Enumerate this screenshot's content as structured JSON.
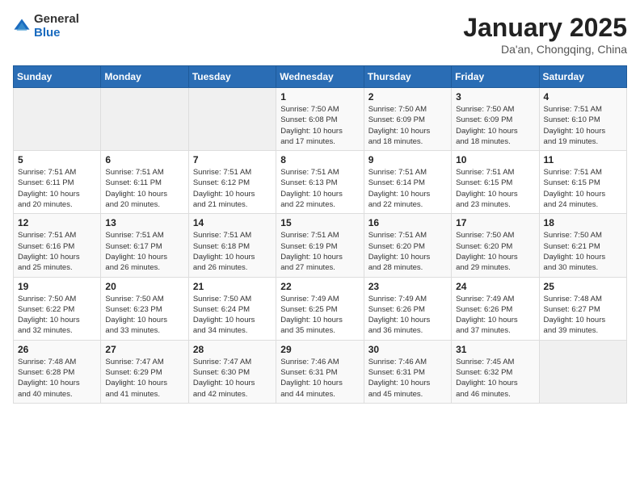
{
  "header": {
    "logo_general": "General",
    "logo_blue": "Blue",
    "title": "January 2025",
    "location": "Da'an, Chongqing, China"
  },
  "weekdays": [
    "Sunday",
    "Monday",
    "Tuesday",
    "Wednesday",
    "Thursday",
    "Friday",
    "Saturday"
  ],
  "weeks": [
    [
      {
        "day": "",
        "info": ""
      },
      {
        "day": "",
        "info": ""
      },
      {
        "day": "",
        "info": ""
      },
      {
        "day": "1",
        "info": "Sunrise: 7:50 AM\nSunset: 6:08 PM\nDaylight: 10 hours\nand 17 minutes."
      },
      {
        "day": "2",
        "info": "Sunrise: 7:50 AM\nSunset: 6:09 PM\nDaylight: 10 hours\nand 18 minutes."
      },
      {
        "day": "3",
        "info": "Sunrise: 7:50 AM\nSunset: 6:09 PM\nDaylight: 10 hours\nand 18 minutes."
      },
      {
        "day": "4",
        "info": "Sunrise: 7:51 AM\nSunset: 6:10 PM\nDaylight: 10 hours\nand 19 minutes."
      }
    ],
    [
      {
        "day": "5",
        "info": "Sunrise: 7:51 AM\nSunset: 6:11 PM\nDaylight: 10 hours\nand 20 minutes."
      },
      {
        "day": "6",
        "info": "Sunrise: 7:51 AM\nSunset: 6:11 PM\nDaylight: 10 hours\nand 20 minutes."
      },
      {
        "day": "7",
        "info": "Sunrise: 7:51 AM\nSunset: 6:12 PM\nDaylight: 10 hours\nand 21 minutes."
      },
      {
        "day": "8",
        "info": "Sunrise: 7:51 AM\nSunset: 6:13 PM\nDaylight: 10 hours\nand 22 minutes."
      },
      {
        "day": "9",
        "info": "Sunrise: 7:51 AM\nSunset: 6:14 PM\nDaylight: 10 hours\nand 22 minutes."
      },
      {
        "day": "10",
        "info": "Sunrise: 7:51 AM\nSunset: 6:15 PM\nDaylight: 10 hours\nand 23 minutes."
      },
      {
        "day": "11",
        "info": "Sunrise: 7:51 AM\nSunset: 6:15 PM\nDaylight: 10 hours\nand 24 minutes."
      }
    ],
    [
      {
        "day": "12",
        "info": "Sunrise: 7:51 AM\nSunset: 6:16 PM\nDaylight: 10 hours\nand 25 minutes."
      },
      {
        "day": "13",
        "info": "Sunrise: 7:51 AM\nSunset: 6:17 PM\nDaylight: 10 hours\nand 26 minutes."
      },
      {
        "day": "14",
        "info": "Sunrise: 7:51 AM\nSunset: 6:18 PM\nDaylight: 10 hours\nand 26 minutes."
      },
      {
        "day": "15",
        "info": "Sunrise: 7:51 AM\nSunset: 6:19 PM\nDaylight: 10 hours\nand 27 minutes."
      },
      {
        "day": "16",
        "info": "Sunrise: 7:51 AM\nSunset: 6:20 PM\nDaylight: 10 hours\nand 28 minutes."
      },
      {
        "day": "17",
        "info": "Sunrise: 7:50 AM\nSunset: 6:20 PM\nDaylight: 10 hours\nand 29 minutes."
      },
      {
        "day": "18",
        "info": "Sunrise: 7:50 AM\nSunset: 6:21 PM\nDaylight: 10 hours\nand 30 minutes."
      }
    ],
    [
      {
        "day": "19",
        "info": "Sunrise: 7:50 AM\nSunset: 6:22 PM\nDaylight: 10 hours\nand 32 minutes."
      },
      {
        "day": "20",
        "info": "Sunrise: 7:50 AM\nSunset: 6:23 PM\nDaylight: 10 hours\nand 33 minutes."
      },
      {
        "day": "21",
        "info": "Sunrise: 7:50 AM\nSunset: 6:24 PM\nDaylight: 10 hours\nand 34 minutes."
      },
      {
        "day": "22",
        "info": "Sunrise: 7:49 AM\nSunset: 6:25 PM\nDaylight: 10 hours\nand 35 minutes."
      },
      {
        "day": "23",
        "info": "Sunrise: 7:49 AM\nSunset: 6:26 PM\nDaylight: 10 hours\nand 36 minutes."
      },
      {
        "day": "24",
        "info": "Sunrise: 7:49 AM\nSunset: 6:26 PM\nDaylight: 10 hours\nand 37 minutes."
      },
      {
        "day": "25",
        "info": "Sunrise: 7:48 AM\nSunset: 6:27 PM\nDaylight: 10 hours\nand 39 minutes."
      }
    ],
    [
      {
        "day": "26",
        "info": "Sunrise: 7:48 AM\nSunset: 6:28 PM\nDaylight: 10 hours\nand 40 minutes."
      },
      {
        "day": "27",
        "info": "Sunrise: 7:47 AM\nSunset: 6:29 PM\nDaylight: 10 hours\nand 41 minutes."
      },
      {
        "day": "28",
        "info": "Sunrise: 7:47 AM\nSunset: 6:30 PM\nDaylight: 10 hours\nand 42 minutes."
      },
      {
        "day": "29",
        "info": "Sunrise: 7:46 AM\nSunset: 6:31 PM\nDaylight: 10 hours\nand 44 minutes."
      },
      {
        "day": "30",
        "info": "Sunrise: 7:46 AM\nSunset: 6:31 PM\nDaylight: 10 hours\nand 45 minutes."
      },
      {
        "day": "31",
        "info": "Sunrise: 7:45 AM\nSunset: 6:32 PM\nDaylight: 10 hours\nand 46 minutes."
      },
      {
        "day": "",
        "info": ""
      }
    ]
  ]
}
